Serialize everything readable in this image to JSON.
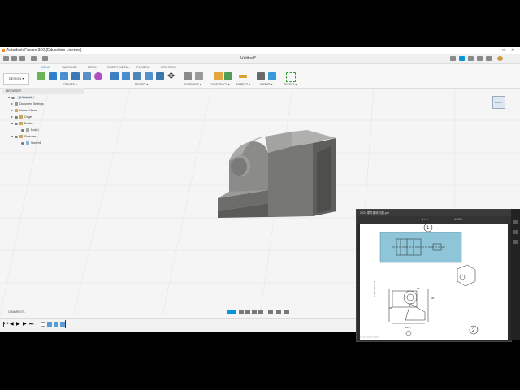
{
  "window": {
    "title": "Autodesk Fusion 360 (Education License)",
    "document": "Untitled*"
  },
  "tabs": [
    "SOLID",
    "SURFACE",
    "MESH",
    "SHEET METAL",
    "PLASTIC",
    "UTILITIES"
  ],
  "active_tab": "SOLID",
  "workspace": "DESIGN ▾",
  "ribbon_groups": [
    "CREATE ▾",
    "MODIFY ▾",
    "ASSEMBLE ▾",
    "CONSTRUCT ▾",
    "INSPECT ▾",
    "INSERT ▾",
    "SELECT ▾"
  ],
  "browser": {
    "header": "BROWSER",
    "root": "(Unsaved)",
    "items": [
      "Document Settings",
      "Named Views",
      "Origin",
      "Bodies",
      "Body1",
      "Sketches",
      "Sketch1"
    ]
  },
  "viewcube": "FRONT",
  "comments": "COMMENTS",
  "pdf": {
    "title": "2024 零件图练习图.pdf",
    "page_indicator": "1 / 4",
    "zoom": "100%",
    "page_numbers": [
      "1",
      "2"
    ],
    "status": "2156×1578  200%"
  },
  "colors": {
    "accent": "#0696d7",
    "model": "#7a7a78",
    "highlight": "#8ec5d9"
  }
}
